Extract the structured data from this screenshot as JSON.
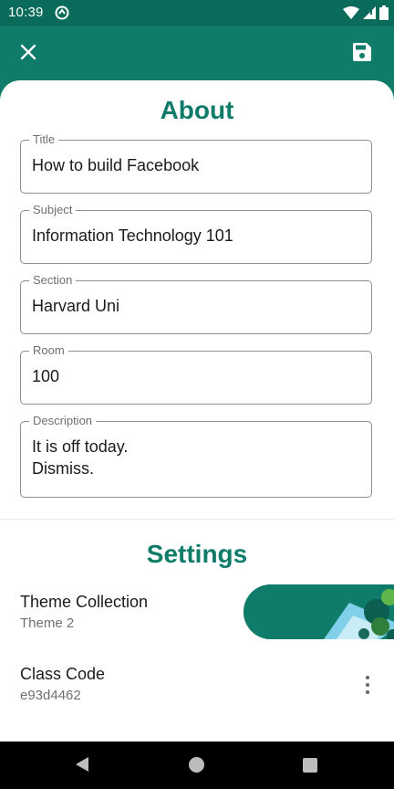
{
  "status_bar": {
    "time": "10:39"
  },
  "app_bar": {
    "close_icon": "close-icon",
    "save_icon": "save-icon"
  },
  "about": {
    "title": "About",
    "fields": [
      {
        "label": "Title",
        "value": "How to build Facebook"
      },
      {
        "label": "Subject",
        "value": "Information Technology 101"
      },
      {
        "label": "Section",
        "value": "Harvard Uni"
      },
      {
        "label": "Room",
        "value": "100"
      },
      {
        "label": "Description",
        "value": "It is off today.\nDismiss."
      }
    ]
  },
  "settings": {
    "title": "Settings",
    "theme": {
      "label": "Theme Collection",
      "value": "Theme 2"
    },
    "class_code": {
      "label": "Class Code",
      "value": "e93d4462"
    }
  },
  "colors": {
    "primary": "#0f7b69",
    "status_bar": "#0b6b5b",
    "text": "#1b1b1b",
    "secondary_text": "#6f6f6f"
  }
}
